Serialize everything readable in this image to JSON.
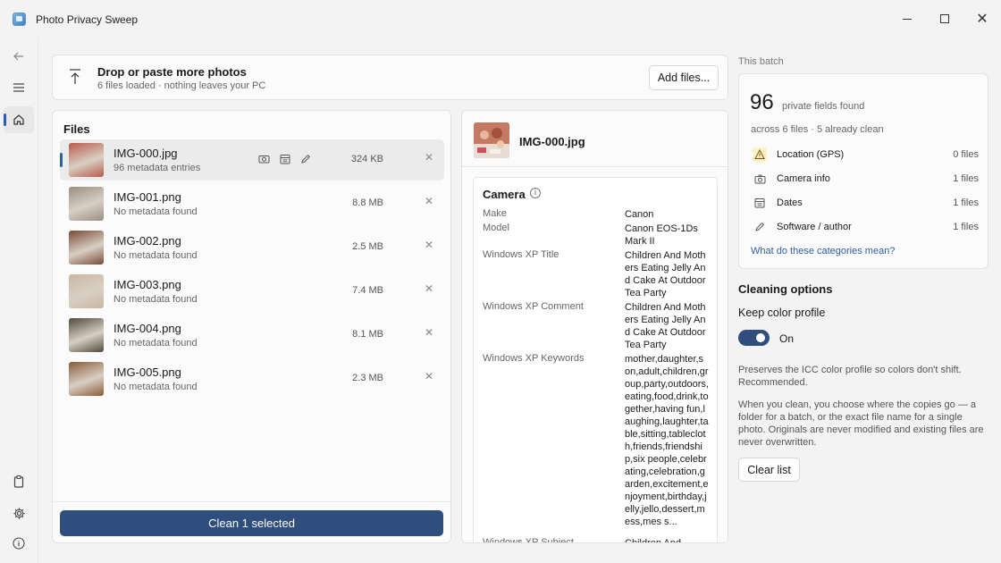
{
  "window": {
    "title": "Photo Privacy Sweep",
    "icon": "app-photo-icon"
  },
  "nav": {
    "items": [
      "back-arrow-icon",
      "menu-icon",
      "home-icon",
      "clipboard-icon",
      "gear-icon",
      "info-icon"
    ],
    "active": "home-icon"
  },
  "dropzone": {
    "title": "Drop or paste more photos",
    "subtitle": "6 files loaded · nothing leaves your PC",
    "add_label": "Add files..."
  },
  "files": {
    "heading": "Files",
    "rows": [
      {
        "name": "IMG-000.jpg",
        "sub": "96 metadata entries",
        "size": "324 KB",
        "selected": true,
        "thumb": "#b85a4a"
      },
      {
        "name": "IMG-001.png",
        "sub": "No metadata found",
        "size": "8.8 MB",
        "selected": false,
        "thumb": "#9a8e84"
      },
      {
        "name": "IMG-002.png",
        "sub": "No metadata found",
        "size": "2.5 MB",
        "selected": false,
        "thumb": "#7a4a36"
      },
      {
        "name": "IMG-003.png",
        "sub": "No metadata found",
        "size": "7.4 MB",
        "selected": false,
        "thumb": "#c9b8a0"
      },
      {
        "name": "IMG-004.png",
        "sub": "No metadata found",
        "size": "8.1 MB",
        "selected": false,
        "thumb": "#4e4a3e"
      },
      {
        "name": "IMG-005.png",
        "sub": "No metadata found",
        "size": "2.3 MB",
        "selected": false,
        "thumb": "#8a5a36"
      }
    ],
    "clean_label": "Clean 1 selected"
  },
  "detail": {
    "filename": "IMG-000.jpg",
    "section": "Camera",
    "meta": [
      {
        "key": "Make",
        "value": "Canon"
      },
      {
        "key": "Model",
        "value": "Canon EOS-1Ds Mark II"
      },
      {
        "key": "Windows XP Title",
        "value": "Children And Mothers Eating Jelly And Cake At Outdoor Tea Party"
      },
      {
        "key": "Windows XP Comment",
        "value": "Children And Mothers Eating Jelly And Cake At Outdoor Tea Party"
      },
      {
        "key": "Windows XP Keywords",
        "value": "mother,daughter,son,adult,children,group,party,outdoors,eating,food,drink,together,having fun,laughing,laughter,table,sitting,tablecloth,friends,friendship,six people,celebrating,celebration,garden,excitement,enjoyment,birthday,jelly,jello,dessert,mess,mes s..."
      },
      {
        "key": "Windows XP Subject",
        "value": "Children And"
      }
    ]
  },
  "batch": {
    "label": "This batch",
    "count": "96",
    "count_label": "private fields found",
    "sub": "across 6 files · 5 already clean",
    "categories": [
      {
        "label": "Location (GPS)",
        "count": "0 files",
        "icon": "warning-icon"
      },
      {
        "label": "Camera info",
        "count": "1 files",
        "icon": "camera-icon"
      },
      {
        "label": "Dates",
        "count": "1 files",
        "icon": "calendar-icon"
      },
      {
        "label": "Software / author",
        "count": "1 files",
        "icon": "pencil-icon"
      }
    ],
    "link": "What do these categories mean?"
  },
  "options": {
    "title": "Cleaning options",
    "keep_color_label": "Keep color profile",
    "toggle_state": "On",
    "desc": "Preserves the ICC color profile so colors don't shift. Recommended.",
    "desc2": "When you clean, you choose where the copies go — a folder for a batch, or the exact file name for a single photo. Originals are never modified and existing files are never overwritten.",
    "clear_label": "Clear list"
  },
  "colors": {
    "accent": "#2f4d7d",
    "link": "#2d5ea8",
    "warn_bg": "#fff1c7"
  }
}
